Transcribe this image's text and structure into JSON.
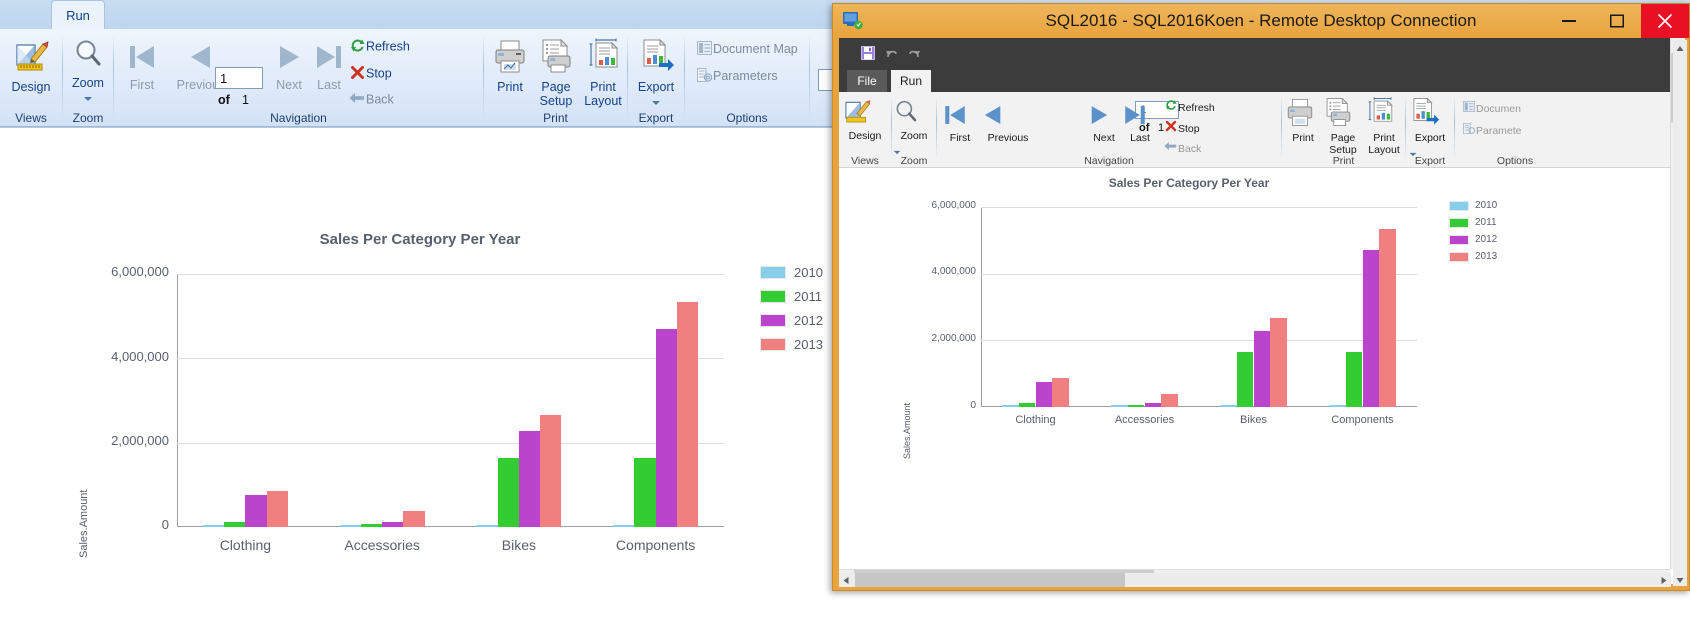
{
  "background_app": {
    "tab_label": "Run",
    "groups": [
      {
        "name": "Views",
        "label": "Views"
      },
      {
        "name": "Zoom",
        "label": "Zoom"
      },
      {
        "name": "Navigation",
        "label": "Navigation"
      },
      {
        "name": "Print",
        "label": "Print"
      },
      {
        "name": "Export",
        "label": "Export"
      },
      {
        "name": "Options",
        "label": "Options"
      }
    ],
    "buttons": {
      "design": "Design",
      "zoom": "Zoom",
      "first": "First",
      "previous": "Previous",
      "next": "Next",
      "last": "Last",
      "refresh": "Refresh",
      "stop": "Stop",
      "back": "Back",
      "print": "Print",
      "page_setup_line1": "Page",
      "page_setup_line2": "Setup",
      "print_layout_line1": "Print",
      "print_layout_line2": "Layout",
      "export": "Export",
      "document_map": "Document Map",
      "parameters": "Parameters"
    },
    "page_number": "1",
    "of_text": "of",
    "page_total": "1"
  },
  "rdp_window": {
    "title": "SQL2016 - SQL2016Koen - Remote Desktop Connection",
    "controls": {
      "minimize": "minimize-icon",
      "maximize": "maximize-icon",
      "close": "close-icon"
    },
    "quick_access": [
      "save-icon",
      "undo-icon",
      "redo-icon"
    ],
    "tabs": [
      {
        "label": "File",
        "active": false
      },
      {
        "label": "Run",
        "active": true
      }
    ],
    "groups": [
      {
        "name": "Views",
        "label": "Views"
      },
      {
        "name": "Zoom",
        "label": "Zoom"
      },
      {
        "name": "Navigation",
        "label": "Navigation"
      },
      {
        "name": "Print",
        "label": "Print"
      },
      {
        "name": "Export",
        "label": "Export"
      },
      {
        "name": "Options",
        "label": "Options"
      }
    ],
    "buttons": {
      "design": "Design",
      "zoom": "Zoom",
      "first": "First",
      "previous": "Previous",
      "next": "Next",
      "last": "Last",
      "refresh": "Refresh",
      "stop": "Stop",
      "back": "Back",
      "print": "Print",
      "page_setup_line1": "Page",
      "page_setup_line2": "Setup",
      "print_layout_line1": "Print",
      "print_layout_line2": "Layout",
      "export": "Export",
      "document_map": "Documen",
      "parameters": "Paramete"
    },
    "page_number": "1",
    "of_text": "of",
    "page_total": "1"
  },
  "colors": {
    "year_2010": "#87ceeb",
    "year_2011": "#33cc33",
    "year_2012": "#bb44cc",
    "year_2013": "#f08080",
    "title_text": "#5a5f6e",
    "gridline": "#dddddd",
    "rdp_frame": "#e8a33d",
    "ribbon_blue": "#15428b"
  },
  "chart_data": {
    "type": "bar",
    "title": "Sales Per Category Per Year",
    "xlabel": "",
    "ylabel": "Sales.Amount",
    "ylim": [
      0,
      6000000
    ],
    "yticks": [
      0,
      2000000,
      4000000,
      6000000
    ],
    "ytick_labels": [
      "0",
      "2,000,000",
      "4,000,000",
      "6,000,000"
    ],
    "grid": true,
    "legend_position": "right",
    "categories": [
      "Clothing",
      "Accessories",
      "Bikes",
      "Components"
    ],
    "series": [
      {
        "name": "2010",
        "color": "#87ceeb",
        "values": [
          20000,
          18000,
          50000,
          30000
        ]
      },
      {
        "name": "2011",
        "color": "#33cc33",
        "values": [
          110000,
          60000,
          1640000,
          1640000
        ]
      },
      {
        "name": "2012",
        "color": "#bb44cc",
        "values": [
          760000,
          130000,
          2270000,
          4700000
        ]
      },
      {
        "name": "2013",
        "color": "#f08080",
        "values": [
          860000,
          380000,
          2660000,
          5330000
        ]
      }
    ]
  }
}
